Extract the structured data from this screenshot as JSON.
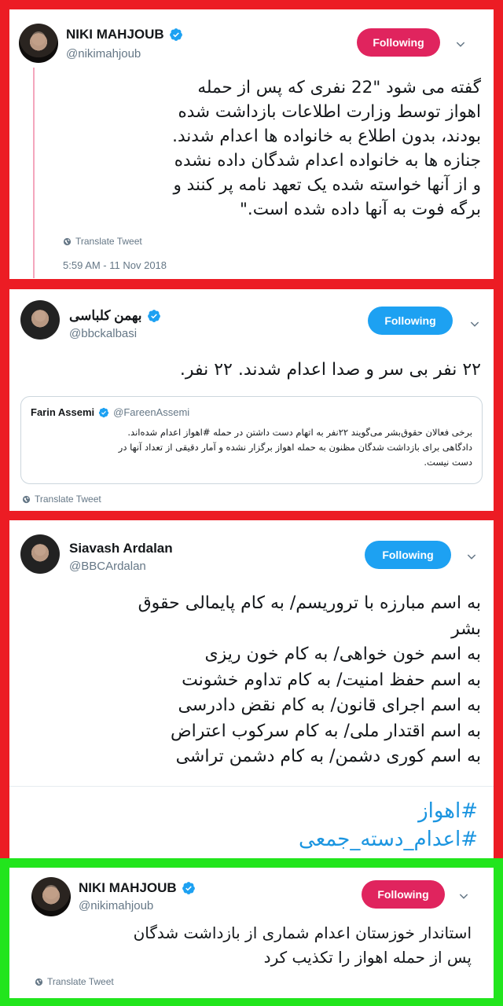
{
  "tweets": [
    {
      "name": "NIKI MAHJOUB",
      "handle": "@nikimahjoub",
      "follow_label": "Following",
      "text_lines": [
        "گفته می شود \"22 نفری که پس از حمله",
        "اهواز توسط وزارت اطلاعات بازداشت شده",
        "بودند، بدون اطلاع به خانواده ها اعدام شدند.",
        "جنازه ها به خانواده اعدام شدگان داده نشده",
        "و از آنها خواسته شده یک تعهد نامه پر کنند و",
        "برگه فوت به آنها داده شده است.\""
      ],
      "translate_label": "Translate Tweet",
      "timestamp": "5:59 AM - 11 Nov 2018"
    },
    {
      "name": "بهمن کلباسی",
      "handle": "@bbckalbasi",
      "follow_label": "Following",
      "text": "۲۲ نفر بی سر و صدا اعدام شدند. ۲۲ نفر.",
      "quote": {
        "name": "Farin Assemi",
        "handle": "@FareenAssemi",
        "text_lines": [
          "برخی فعالان حقوق‌بشر می‌گویند ۲۲نفر به اتهام دست داشتن در حمله #اهواز اعدام شده‌اند.",
          "دادگاهی برای بازداشت شدگان مظنون به حمله اهواز برگزار نشده و آمار دقیقی از تعداد آنها در",
          "دست نیست."
        ]
      },
      "translate_label": "Translate Tweet"
    },
    {
      "name": "Siavash Ardalan",
      "handle": "@BBCArdalan",
      "follow_label": "Following",
      "text_lines": [
        "به اسم مبارزه با تروریسم/ به کام پایمالی حقوق",
        "بشر",
        "به اسم خون خواهی/ به کام خون ریزی",
        "به اسم حفظ امنیت/ به کام تداوم خشونت",
        "به اسم اجرای قانون/ به کام نقض دادرسی",
        "به اسم اقتدار ملی/ به کام سرکوب اعتراض",
        "به اسم کوری دشمن/ به کام دشمن تراشی"
      ],
      "hashtags": [
        "#اهواز",
        "#اعدام_دسته_جمعی"
      ]
    },
    {
      "name": "NIKI MAHJOUB",
      "handle": "@nikimahjoub",
      "follow_label": "Following",
      "text_lines": [
        "استاندار خوزستان اعدام شماری از بازداشت شدگان",
        "پس از حمله اهواز را تکذیب کرد"
      ],
      "translate_label": "Translate Tweet"
    }
  ],
  "colors": {
    "frame_red": "#ec1c24",
    "frame_green": "#22e51d",
    "follow_pink": "#e0245e",
    "follow_blue": "#1da1f2",
    "link_blue": "#1b95e0",
    "verified_blue": "#1da1f2"
  },
  "icons": [
    "verified-badge-icon",
    "chevron-down-icon",
    "globe-icon"
  ]
}
